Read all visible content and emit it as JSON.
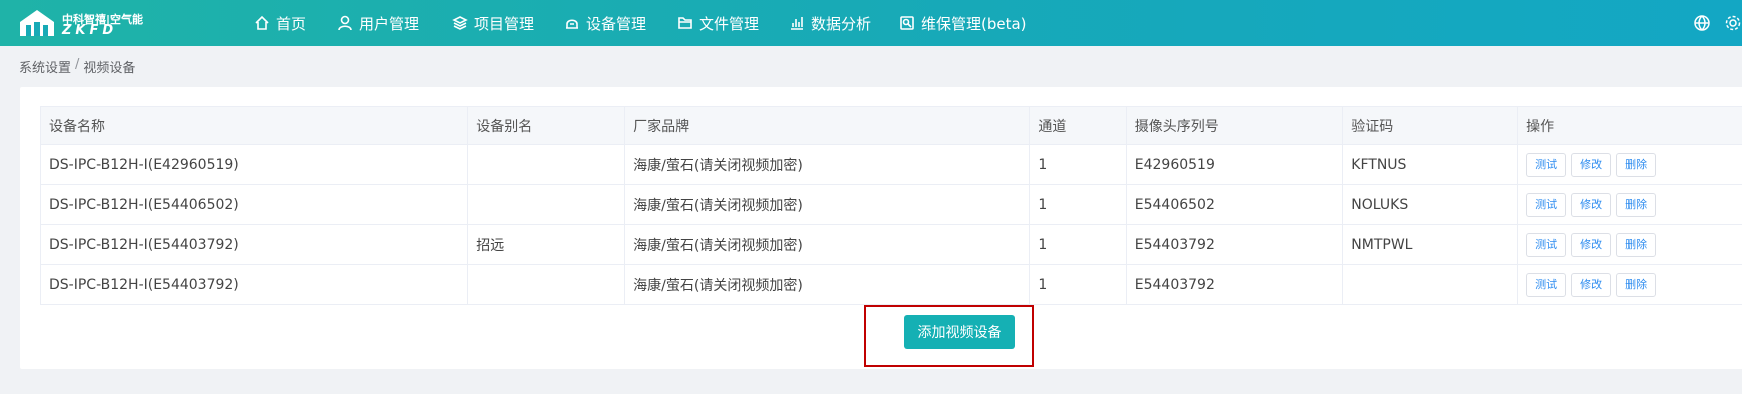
{
  "brand": {
    "cn": "中科智禧|空气能",
    "en": "ZKFD"
  },
  "nav": [
    {
      "label": "首页",
      "icon": "home-icon"
    },
    {
      "label": "用户管理",
      "icon": "user-icon"
    },
    {
      "label": "项目管理",
      "icon": "layers-icon"
    },
    {
      "label": "设备管理",
      "icon": "device-icon"
    },
    {
      "label": "文件管理",
      "icon": "folder-icon"
    },
    {
      "label": "数据分析",
      "icon": "chart-icon"
    },
    {
      "label": "维保管理(beta)",
      "icon": "maintenance-icon"
    }
  ],
  "top_right_icons": [
    "globe-icon",
    "settings-icon"
  ],
  "breadcrumb": {
    "parent": "系统设置",
    "separator": "/",
    "current": "视频设备"
  },
  "table": {
    "headers": [
      "设备名称",
      "设备别名",
      "厂家品牌",
      "通道",
      "摄像头序列号",
      "验证码",
      "操作"
    ],
    "rows": [
      {
        "name": "DS-IPC-B12H-I(E42960519)",
        "alias": "",
        "brand": "海康/萤石(请关闭视频加密)",
        "channel": "1",
        "serial": "E42960519",
        "code": "KFTNUS"
      },
      {
        "name": "DS-IPC-B12H-I(E54406502)",
        "alias": "",
        "brand": "海康/萤石(请关闭视频加密)",
        "channel": "1",
        "serial": "E54406502",
        "code": "NOLUKS"
      },
      {
        "name": "DS-IPC-B12H-I(E54403792)",
        "alias": "招远",
        "brand": "海康/萤石(请关闭视频加密)",
        "channel": "1",
        "serial": "E54403792",
        "code": "NMTPWL"
      },
      {
        "name": "DS-IPC-B12H-I(E54403792)",
        "alias": "",
        "brand": "海康/萤石(请关闭视频加密)",
        "channel": "1",
        "serial": "E54403792",
        "code": ""
      }
    ],
    "actions": {
      "test": "测试",
      "edit": "修改",
      "delete": "删除"
    }
  },
  "add_button_label": "添加视频设备",
  "colors": {
    "header_start": "#1fb3a8",
    "header_end": "#13a7c4",
    "primary_button": "#15b0b4",
    "highlight_box": "#c00000",
    "link_blue": "#2d8cf0"
  }
}
